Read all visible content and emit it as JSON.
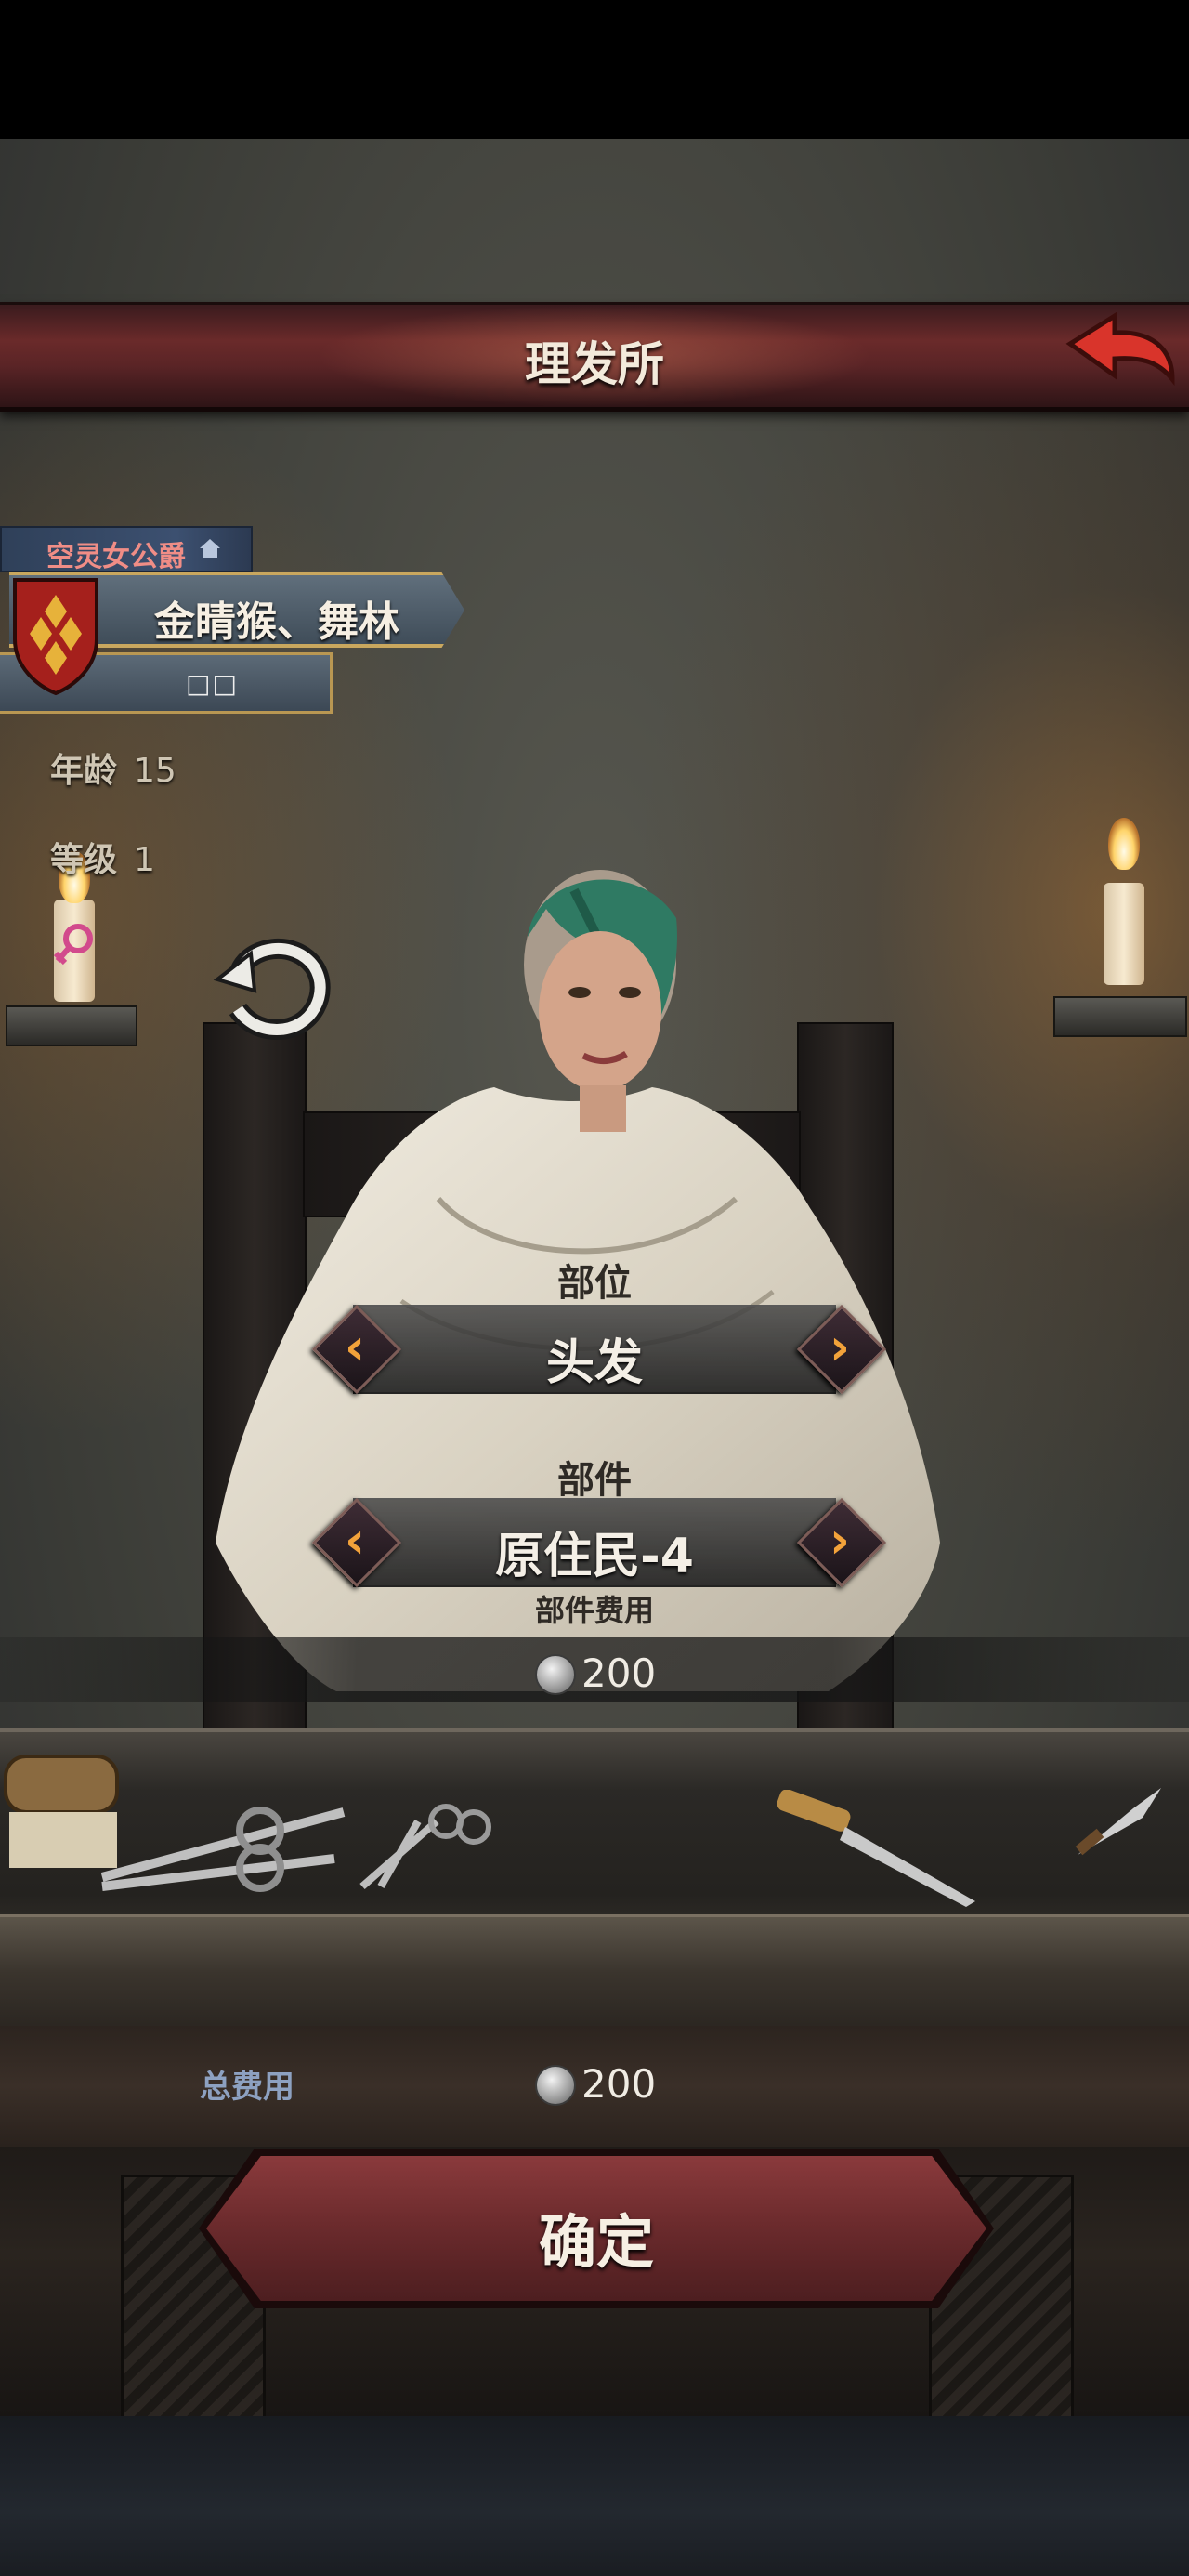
{
  "header": {
    "title": "理发所"
  },
  "character": {
    "rank_title": "空灵女公爵",
    "name": "金睛猴、舞林",
    "subtitle": "□□",
    "stats": [
      {
        "label": "年龄",
        "value": "15"
      },
      {
        "label": "等级",
        "value": "1"
      }
    ]
  },
  "slot_selector": {
    "label": "部位",
    "value": "头发"
  },
  "part_selector": {
    "label": "部件",
    "value": "原住民-4"
  },
  "part_cost": {
    "label": "部件费用",
    "value": "200"
  },
  "total_cost": {
    "label": "总费用",
    "value": "200"
  },
  "confirm": {
    "label": "确定"
  },
  "colors": {
    "accent": "#f2a23a",
    "banner": "#6a2a2a",
    "hair": "#2f7a63"
  }
}
